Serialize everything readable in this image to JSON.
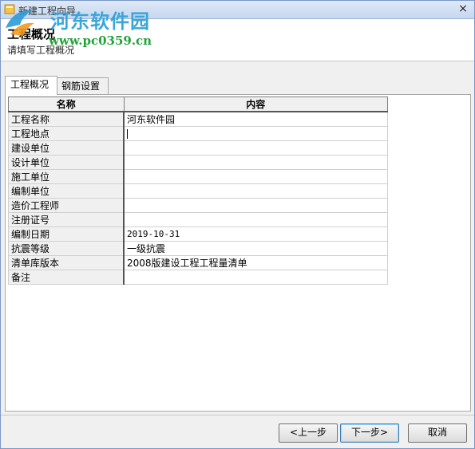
{
  "window": {
    "title": "新建工程向导",
    "close_glyph": "×"
  },
  "header": {
    "title": "工程概况",
    "subtitle": "请填写工程概况"
  },
  "watermark": {
    "site_name": "河东软件园",
    "url": "www.pc0359.cn"
  },
  "tabs": [
    {
      "label": "工程概况",
      "active": true
    },
    {
      "label": "钢筋设置",
      "active": false
    }
  ],
  "table": {
    "headers": {
      "name": "名称",
      "content": "内容"
    },
    "rows": [
      {
        "name": "工程名称",
        "value": "河东软件园"
      },
      {
        "name": "工程地点",
        "value": ""
      },
      {
        "name": "建设单位",
        "value": ""
      },
      {
        "name": "设计单位",
        "value": ""
      },
      {
        "name": "施工单位",
        "value": ""
      },
      {
        "name": "编制单位",
        "value": ""
      },
      {
        "name": "造价工程师",
        "value": ""
      },
      {
        "name": "注册证号",
        "value": ""
      },
      {
        "name": "编制日期",
        "value": "2019-10-31"
      },
      {
        "name": "抗震等级",
        "value": "一级抗震"
      },
      {
        "name": "清单库版本",
        "value": "2008版建设工程工程量清单"
      },
      {
        "name": "备注",
        "value": ""
      }
    ]
  },
  "buttons": {
    "prev": "<上一步",
    "next": "下一步>",
    "cancel": "取消"
  },
  "colors": {
    "watermark_name": "#3aa6d8",
    "watermark_url": "#21a33a",
    "titlebar": "#c6d7ef"
  },
  "icons": {
    "app": "wizard-app-icon",
    "watermark_logo": "site-logo-icon",
    "close": "close-icon"
  }
}
